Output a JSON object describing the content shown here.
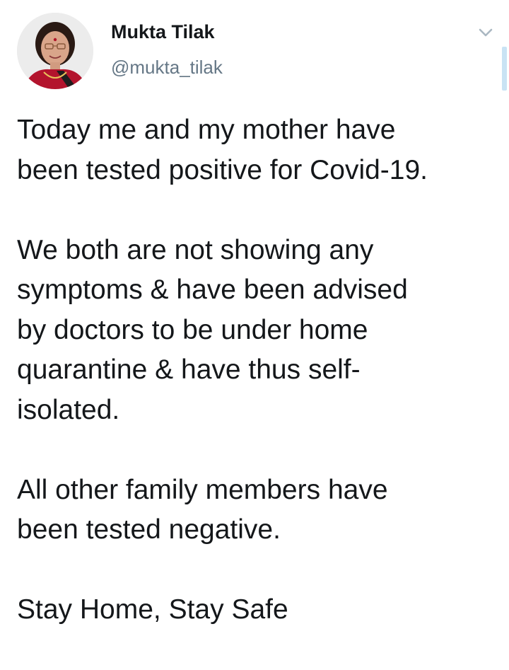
{
  "author": {
    "display_name": "Mukta Tilak",
    "handle": "@mukta_tilak",
    "avatar": "profile-photo"
  },
  "tweet": {
    "paragraphs": [
      [
        "Today me and my mother have",
        "been tested positive for Covid-19."
      ],
      [
        "We both are not showing any",
        "symptoms & have been advised",
        "by doctors to be under home",
        "quarantine & have thus self-",
        "isolated."
      ],
      [
        "All other family members have",
        "been tested negative."
      ],
      [
        "Stay Home, Stay Safe"
      ]
    ]
  },
  "icons": {
    "menu": "chevron-down-icon"
  },
  "colors": {
    "text_primary": "#14171a",
    "text_secondary": "#657786",
    "caret": "#aab8c2",
    "scroll_indicator": "#c9e3f4"
  }
}
